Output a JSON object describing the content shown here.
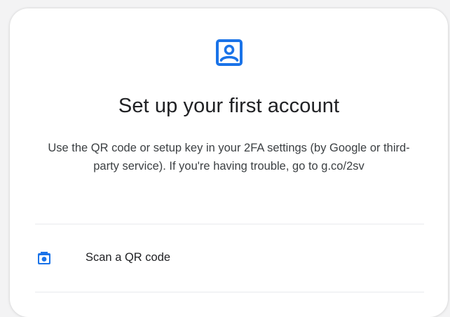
{
  "title": "Set up your first account",
  "description": "Use the QR code or setup key in your 2FA settings (by Google or third-party service). If you're having trouble, go to g.co/2sv",
  "options": [
    {
      "label": "Scan a QR code",
      "icon": "camera-icon"
    }
  ],
  "header_icon": "account-box-icon",
  "colors": {
    "accent": "#1a73e8",
    "text_primary": "#202124",
    "text_secondary": "#3c4043",
    "divider": "#e8eaed",
    "card_background": "#ffffff",
    "page_background": "#f3f3f4"
  }
}
